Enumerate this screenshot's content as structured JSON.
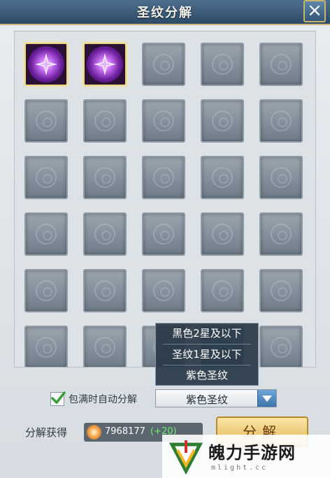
{
  "window": {
    "title": "圣纹分解",
    "close_icon": "close-icon"
  },
  "inventory": {
    "columns": 5,
    "visible_rows": 6,
    "filled_slots": [
      0,
      1
    ],
    "filled_item_icon": "purple-rune-icon",
    "empty_slot_icon": "rune-emblem-icon"
  },
  "filter_menu": {
    "items": [
      "黑色2星及以下",
      "圣纹1星及以下",
      "紫色圣纹"
    ]
  },
  "auto_decompose": {
    "label": "包满时自动分解",
    "checked": true
  },
  "filter_select": {
    "value": "紫色圣纹"
  },
  "reward": {
    "label": "分解获得",
    "value": "7968177",
    "bonus": "(+20)"
  },
  "action": {
    "label": "分解"
  },
  "watermark": {
    "text": "魄力手游网",
    "sub": "mlight.cc"
  },
  "colors": {
    "title_bar": "#2c4a67",
    "gold": "#c9b87a",
    "bonus_green": "#6cf06c"
  }
}
